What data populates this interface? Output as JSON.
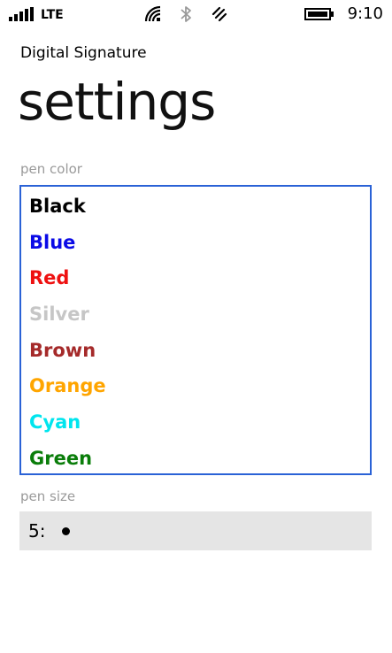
{
  "status_bar": {
    "network": "LTE",
    "time": "9:10",
    "icons": [
      "signal-icon",
      "wifi-icon",
      "bluetooth-icon",
      "location-icon",
      "battery-icon"
    ]
  },
  "header": {
    "app_title": "Digital Signature",
    "page_title": "settings"
  },
  "pen_color": {
    "label": "pen color",
    "options": [
      {
        "label": "Black",
        "color": "#000000"
      },
      {
        "label": "Blue",
        "color": "#0a0ae6"
      },
      {
        "label": "Red",
        "color": "#ee1111"
      },
      {
        "label": "Silver",
        "color": "#c6c6c6"
      },
      {
        "label": "Brown",
        "color": "#a52a2a"
      },
      {
        "label": "Orange",
        "color": "#ffa500"
      },
      {
        "label": "Cyan",
        "color": "#00e5ee"
      },
      {
        "label": "Green",
        "color": "#0a7d0a"
      }
    ]
  },
  "pen_size": {
    "label": "pen size",
    "value": "5:"
  },
  "colors": {
    "accent": "#2a62d6",
    "picker_background": "#e5e5e5",
    "label_gray": "#9a9a9a"
  }
}
